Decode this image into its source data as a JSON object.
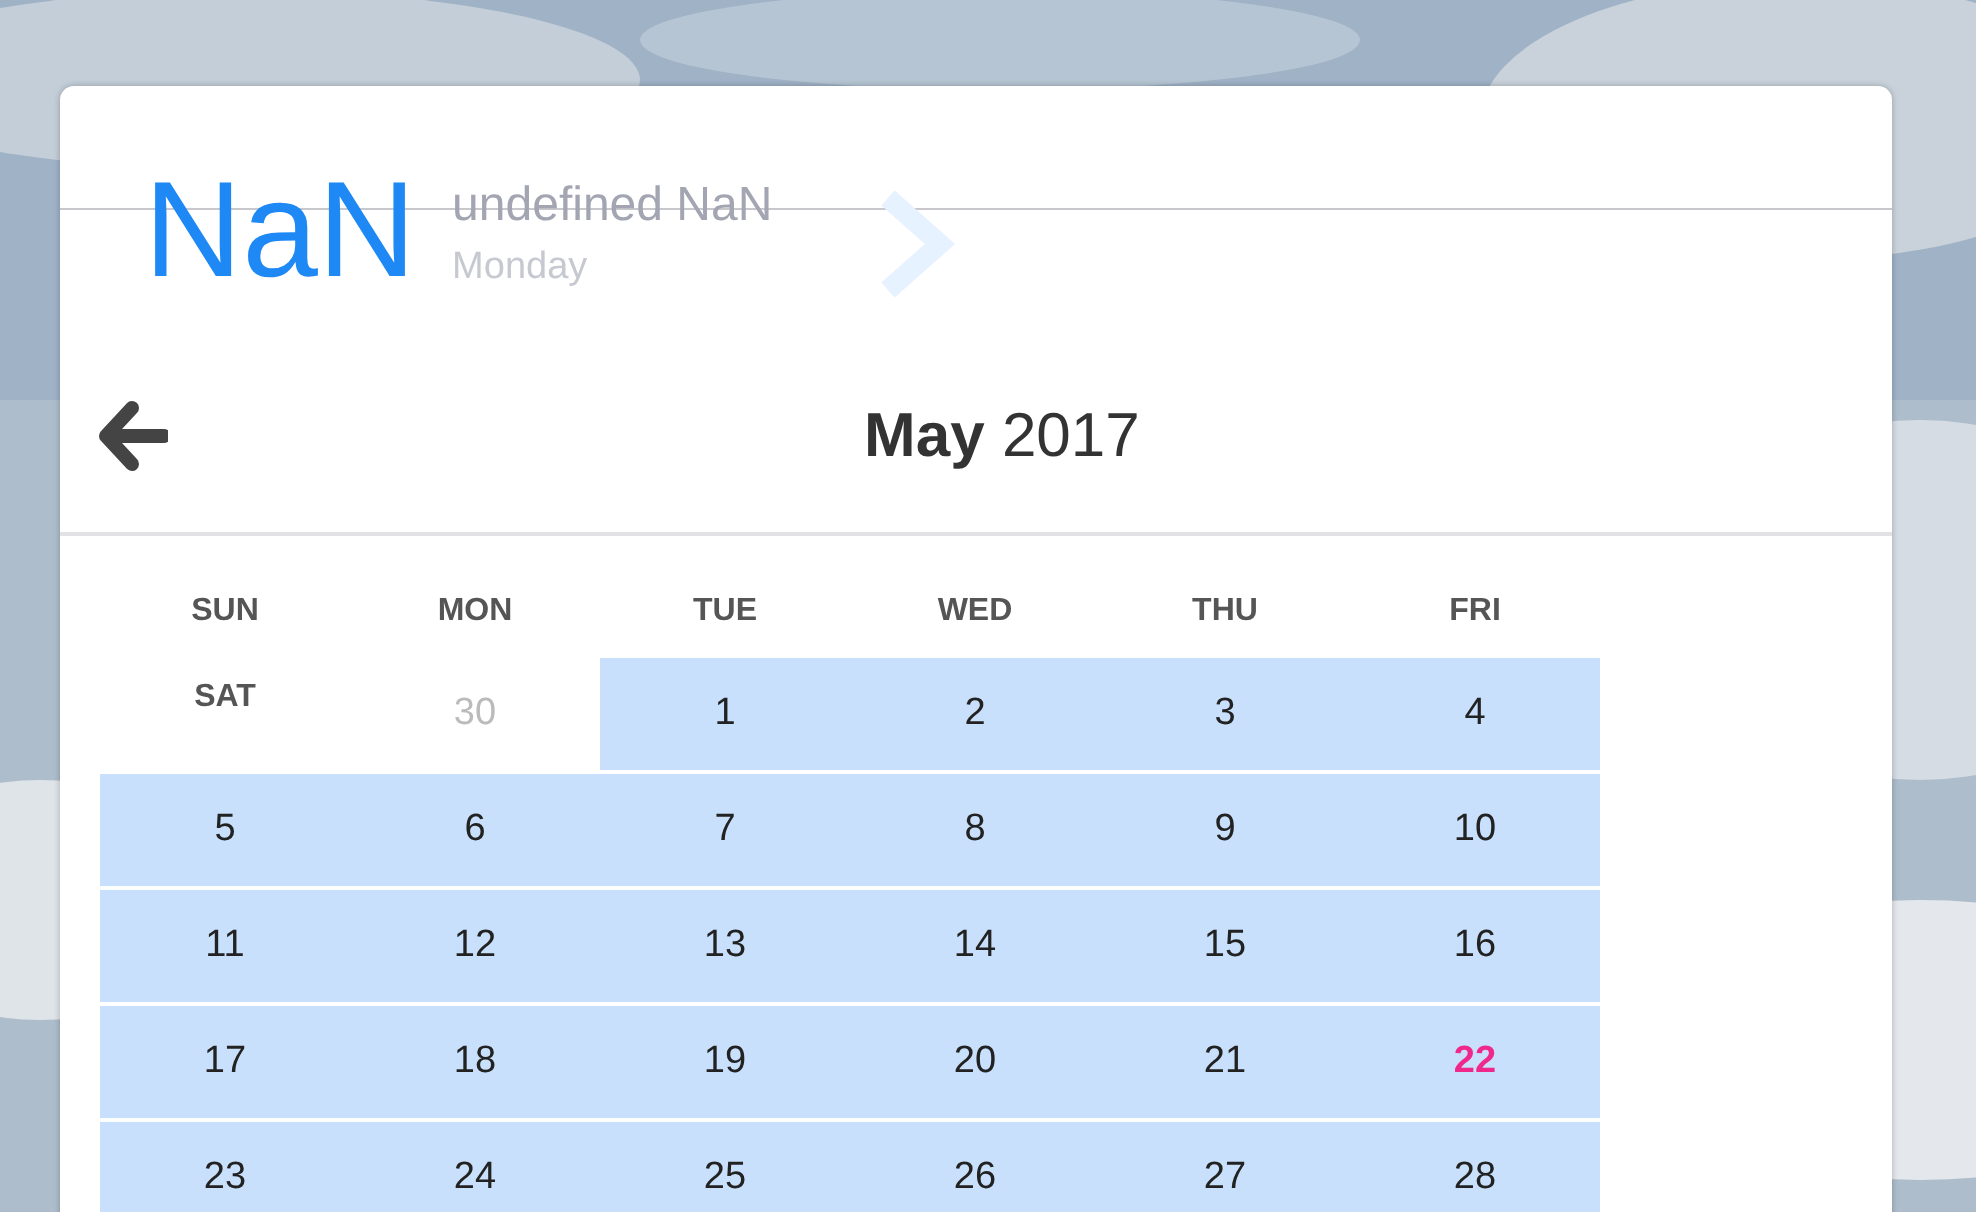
{
  "header": {
    "day_number": "NaN",
    "month_year": "undefined NaN",
    "weekday": "Monday"
  },
  "calendar": {
    "month": "May",
    "year": "2017",
    "weekdays": [
      "SUN",
      "MON",
      "TUE",
      "WED",
      "THU",
      "FRI",
      "SAT"
    ],
    "days": [
      {
        "label": "30",
        "kind": "other",
        "today": false
      },
      {
        "label": "1",
        "kind": "current",
        "today": false
      },
      {
        "label": "2",
        "kind": "current",
        "today": false
      },
      {
        "label": "3",
        "kind": "current",
        "today": false
      },
      {
        "label": "4",
        "kind": "current",
        "today": false
      },
      {
        "label": "5",
        "kind": "current",
        "today": false
      },
      {
        "label": "6",
        "kind": "current",
        "today": false
      },
      {
        "label": "7",
        "kind": "current",
        "today": false
      },
      {
        "label": "8",
        "kind": "current",
        "today": false
      },
      {
        "label": "9",
        "kind": "current",
        "today": false
      },
      {
        "label": "10",
        "kind": "current",
        "today": false
      },
      {
        "label": "11",
        "kind": "current",
        "today": false
      },
      {
        "label": "12",
        "kind": "current",
        "today": false
      },
      {
        "label": "13",
        "kind": "current",
        "today": false
      },
      {
        "label": "14",
        "kind": "current",
        "today": false
      },
      {
        "label": "15",
        "kind": "current",
        "today": false
      },
      {
        "label": "16",
        "kind": "current",
        "today": false
      },
      {
        "label": "17",
        "kind": "current",
        "today": false
      },
      {
        "label": "18",
        "kind": "current",
        "today": false
      },
      {
        "label": "19",
        "kind": "current",
        "today": false
      },
      {
        "label": "20",
        "kind": "current",
        "today": false
      },
      {
        "label": "21",
        "kind": "current",
        "today": false
      },
      {
        "label": "22",
        "kind": "current",
        "today": true
      },
      {
        "label": "23",
        "kind": "current",
        "today": false
      },
      {
        "label": "24",
        "kind": "current",
        "today": false
      },
      {
        "label": "25",
        "kind": "current",
        "today": false
      },
      {
        "label": "26",
        "kind": "current",
        "today": false
      },
      {
        "label": "27",
        "kind": "current",
        "today": false
      },
      {
        "label": "28",
        "kind": "current",
        "today": false
      }
    ]
  }
}
